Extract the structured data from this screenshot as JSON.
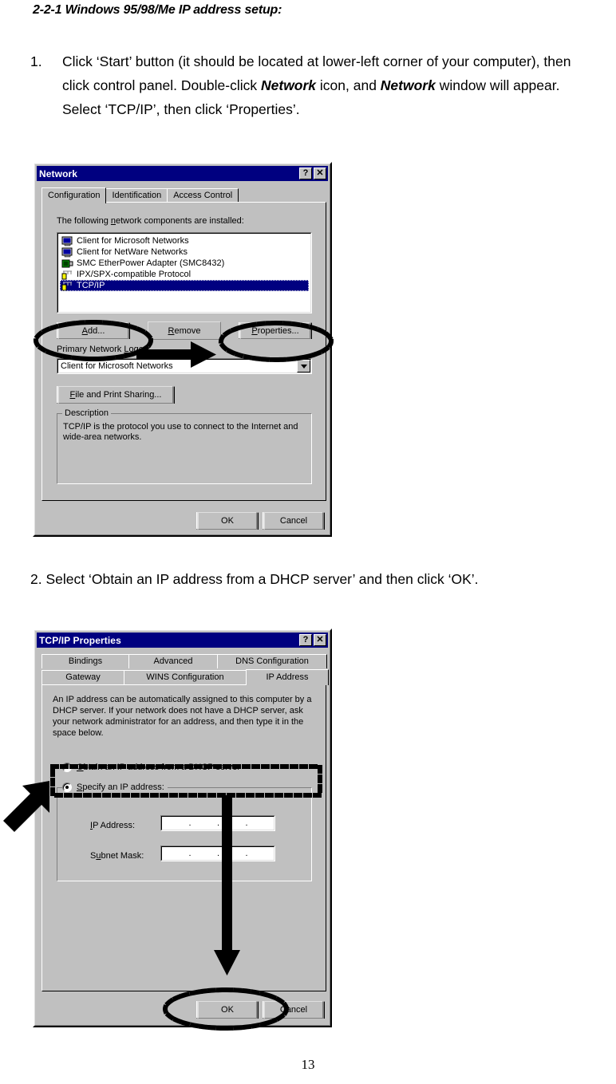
{
  "document": {
    "heading": "2-2-1 Windows 95/98/Me IP address setup:",
    "step1_number": "1.",
    "step1_part1": "Click ‘Start’ button (it should be located at lower-left corner of your computer), then click control panel. Double-click ",
    "step1_network1": "Network",
    "step1_part2": " icon, and ",
    "step1_network2": "Network",
    "step1_part3": " window will appear. Select ‘TCP/IP’, then click ‘Properties’.",
    "step2": "2. Select ‘Obtain an IP address from a DHCP server’ and then click ‘OK’.",
    "page_number": "13"
  },
  "network_dialog": {
    "title": "Network",
    "help_button": "?",
    "close_button": "✕",
    "tabs": [
      {
        "label": "Configuration",
        "selected": true
      },
      {
        "label": "Identification",
        "selected": false
      },
      {
        "label": "Access Control",
        "selected": false
      }
    ],
    "components_label_pre": "The following ",
    "components_label_underlined": "n",
    "components_label_post": "etwork components are installed:",
    "components": [
      {
        "label": "Client for Microsoft Networks",
        "icon": "computer-icon",
        "selected": false
      },
      {
        "label": "Client for NetWare Networks",
        "icon": "computer-icon",
        "selected": false
      },
      {
        "label": "SMC EtherPower Adapter (SMC8432)",
        "icon": "network-adapter-icon",
        "selected": false
      },
      {
        "label": "IPX/SPX-compatible Protocol",
        "icon": "protocol-icon",
        "selected": false
      },
      {
        "label": "TCP/IP",
        "icon": "protocol-icon",
        "selected": true
      }
    ],
    "add_button": "Add...",
    "remove_button": "Remove",
    "properties_button": "Properties...",
    "logon_label": "Primary Network Logon:",
    "logon_value": "Client for Microsoft Networks",
    "file_print_button": "File and Print Sharing...",
    "description_title": "Description",
    "description_text": "TCP/IP is the protocol you use to connect to the Internet and wide-area networks.",
    "ok_button": "OK",
    "cancel_button": "Cancel"
  },
  "tcpip_dialog": {
    "title": "TCP/IP Properties",
    "help_button": "?",
    "close_button": "✕",
    "tabs_row1": [
      {
        "label": "Bindings",
        "selected": false
      },
      {
        "label": "Advanced",
        "selected": false
      },
      {
        "label": "DNS Configuration",
        "selected": false
      }
    ],
    "tabs_row2": [
      {
        "label": "Gateway",
        "selected": false
      },
      {
        "label": "WINS Configuration",
        "selected": false
      },
      {
        "label": "IP Address",
        "selected": true
      }
    ],
    "info_text": "An IP address can be automatically assigned to this computer by a DHCP server. If your network does not have a DHCP server, ask your network administrator for an address, and then type it in the space below.",
    "radio_dhcp": "Obtain an IP address from a DHCP server",
    "radio_dhcp_selected": false,
    "radio_specify": "Specify an IP address:",
    "radio_specify_selected": true,
    "ip_address_label": "IP Address:",
    "ip_address_value": "",
    "subnet_mask_label": "Subnet Mask:",
    "subnet_mask_value": "",
    "ok_button": "OK",
    "cancel_button": "Cancel"
  },
  "annotations": {
    "ellipse_add": "dashed-ellipse-add-button",
    "ellipse_properties": "dashed-ellipse-properties-button",
    "arrow_add_to_properties": "black-arrow-right",
    "rect_dhcp_radio": "dashed-rectangle-dhcp-radio",
    "arrow_to_dhcp_radio": "black-arrow-up-right",
    "arrow_to_ok": "black-arrow-down",
    "ellipse_ok": "dashed-ellipse-ok-button"
  },
  "colors": {
    "title_bar": "#000080",
    "dialog_face": "#c0c0c0",
    "selection": "#000080",
    "annotation": "#000000"
  }
}
